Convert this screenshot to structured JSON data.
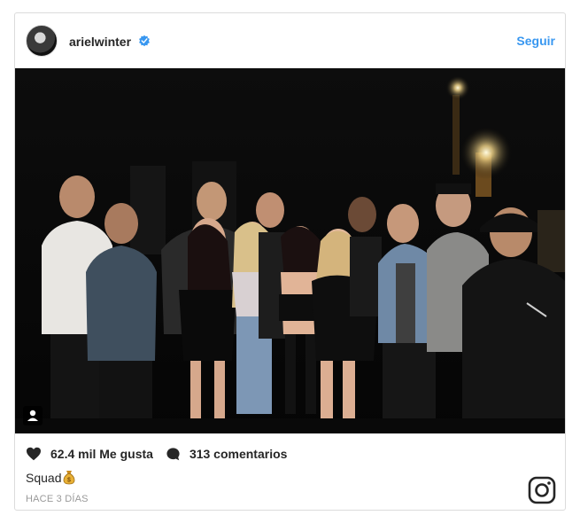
{
  "header": {
    "username": "arielwinter",
    "follow_label": "Seguir",
    "verified_icon": "verified-badge-icon",
    "accent_color": "#3897f0"
  },
  "footer": {
    "likes": "62.4 mil Me gusta",
    "comments": "313 comentarios",
    "caption": "Squad",
    "caption_emoji": "money-bag-icon",
    "date": "HACE 3 DÍAS",
    "logo_icon": "instagram-icon"
  }
}
